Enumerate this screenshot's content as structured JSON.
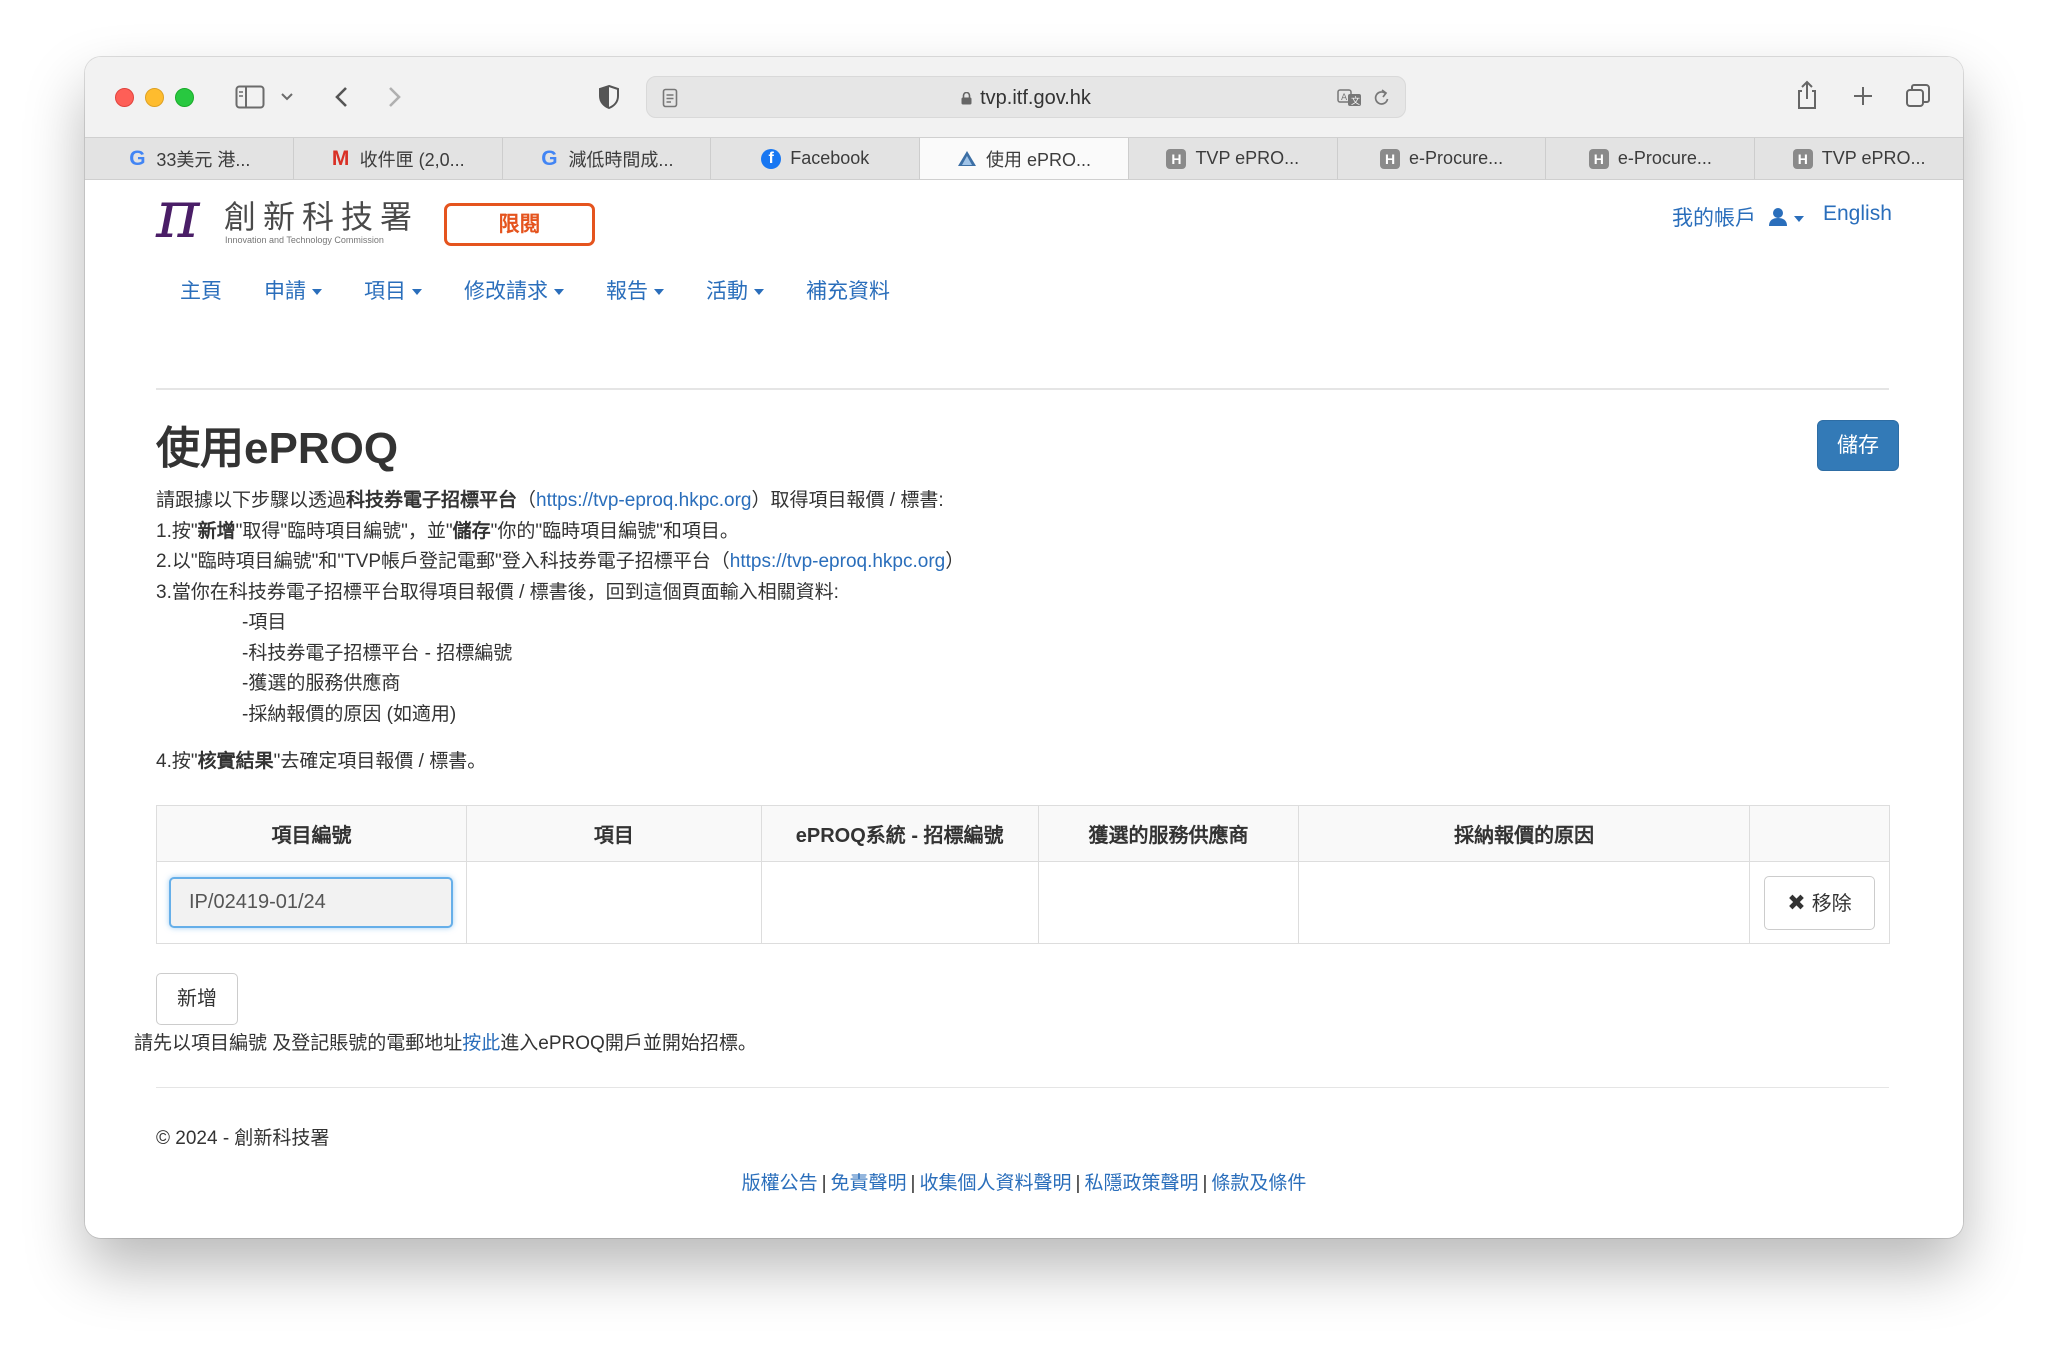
{
  "browser": {
    "url": "tvp.itf.gov.hk",
    "tabs": [
      {
        "label": "33美元 港...",
        "icon": "google-icon"
      },
      {
        "label": "收件匣 (2,0...",
        "icon": "gmail-icon"
      },
      {
        "label": "減低時間成...",
        "icon": "google-icon"
      },
      {
        "label": "Facebook",
        "icon": "facebook-icon"
      },
      {
        "label": "使用 ePRO...",
        "icon": "tvp-icon",
        "active": true
      },
      {
        "label": "TVP ePRO...",
        "icon": "h-icon"
      },
      {
        "label": "e-Procure...",
        "icon": "h-icon"
      },
      {
        "label": "e-Procure...",
        "icon": "h-icon"
      },
      {
        "label": "TVP ePRO...",
        "icon": "h-icon"
      }
    ]
  },
  "header": {
    "logo_name": "創新科技署",
    "logo_sub": "Innovation and Technology Commission",
    "restricted": "限閱",
    "account": "我的帳戶",
    "language": "English"
  },
  "nav": {
    "items": [
      {
        "label": "主頁",
        "dropdown": false
      },
      {
        "label": "申請",
        "dropdown": true
      },
      {
        "label": "項目",
        "dropdown": true
      },
      {
        "label": "修改請求",
        "dropdown": true
      },
      {
        "label": "報告",
        "dropdown": true
      },
      {
        "label": "活動",
        "dropdown": true
      },
      {
        "label": "補充資料",
        "dropdown": false
      }
    ]
  },
  "main": {
    "title": "使用ePROQ",
    "save_label": "儲存",
    "intro_pre": "請跟據以下步驟以透過",
    "intro_bold": "科技券電子招標平台",
    "intro_link": "https://tvp-eproq.hkpc.org",
    "intro_post": "取得項目報價 / 標書:",
    "step1_a": "1.按\"",
    "step1_b": "新增",
    "step1_c": "\"取得\"臨時項目編號\"，並\"",
    "step1_d": "儲存",
    "step1_e": "\"你的\"臨時項目編號\"和項目。",
    "step2_text": "2.以\"臨時項目編號\"和\"TVP帳戶登記電郵\"登入科技券電子招標平台（",
    "step2_link": "https://tvp-eproq.hkpc.org",
    "step3_text": "3.當你在科技券電子招標平台取得項目報價 / 標書後，回到這個頁面輸入相關資料:",
    "step3_items": [
      "-項目",
      "-科技券電子招標平台 - 招標編號",
      "-獲選的服務供應商",
      "-採納報價的原因 (如適用)"
    ],
    "step4_a": "4.按\"",
    "step4_b": "核實結果",
    "step4_c": "\"去確定項目報價 / 標書。"
  },
  "table": {
    "headers": [
      "項目編號",
      "項目",
      "ePROQ系統 - 招標編號",
      "獲選的服務供應商",
      "採納報價的原因",
      ""
    ],
    "rows": [
      {
        "project_no": "IP/02419-01/24",
        "item": "",
        "eproq_no": "",
        "vendor": "",
        "reason": "",
        "remove_label": "移除"
      }
    ]
  },
  "add_label": "新增",
  "note": {
    "pre": "請先以項目編號 及登記賬號的電郵地址",
    "link": "按此",
    "post": "進入ePROQ開戶並開始招標。"
  },
  "footer": {
    "copyright": "© 2024 - 創新科技署",
    "links": [
      "版權公告",
      "免責聲明",
      "收集個人資料聲明",
      "私隱政策聲明",
      "條款及條件"
    ]
  },
  "colors": {
    "link": "#2a6ebb",
    "primary_button": "#337ab7",
    "restricted": "#e5541e",
    "logo": "#4a1e67"
  }
}
